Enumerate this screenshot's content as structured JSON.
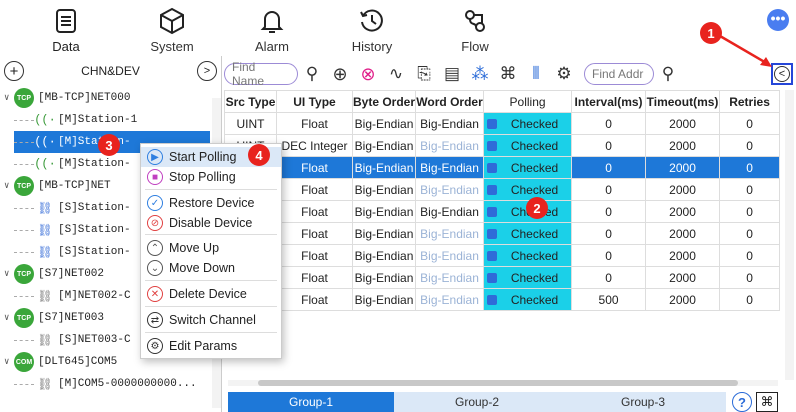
{
  "nav": {
    "tabs": [
      {
        "label": "Data",
        "icon": "list-icon"
      },
      {
        "label": "System",
        "icon": "cube-icon"
      },
      {
        "label": "Alarm",
        "icon": "bell-icon"
      },
      {
        "label": "History",
        "icon": "history-icon"
      },
      {
        "label": "Flow",
        "icon": "flow-icon"
      }
    ],
    "more": "•••"
  },
  "left": {
    "title": "CHN&DEV",
    "tree": [
      {
        "text": "[MB-TCP]NET000",
        "badge": "TCP"
      },
      {
        "text": "[M]Station-1"
      },
      {
        "text": "[M]Station-"
      },
      {
        "text": "[M]Station-"
      },
      {
        "text": "[MB-TCP]NET",
        "badge": "TCP"
      },
      {
        "text": "[S]Station-"
      },
      {
        "text": "[S]Station-"
      },
      {
        "text": "[S]Station-"
      },
      {
        "text": "[S7]NET002",
        "badge": "TCP"
      },
      {
        "text": "[M]NET002-C"
      },
      {
        "text": "[S7]NET003",
        "badge": "TCP"
      },
      {
        "text": "[S]NET003-C"
      },
      {
        "text": "[DLT645]COM5",
        "badge": "COM"
      },
      {
        "text": "[M]COM5-0000000000..."
      }
    ]
  },
  "toolbar": {
    "find_name_placeholder": "Find Name",
    "find_addr_placeholder": "Find Addr"
  },
  "table": {
    "headers": [
      "Src Type",
      "UI Type",
      "Byte Order",
      "Word Order",
      "Polling",
      "Interval(ms)",
      "Timeout(ms)",
      "Retries"
    ],
    "rows": [
      [
        "UINT",
        "Float",
        "Big-Endian",
        "Big-Endian",
        "Checked",
        "0",
        "2000",
        "0"
      ],
      [
        "UINT",
        "DEC Integer",
        "Big-Endian",
        "Big-Endian",
        "Checked",
        "0",
        "2000",
        "0"
      ],
      [
        "",
        "Float",
        "Big-Endian",
        "Big-Endian",
        "Checked",
        "0",
        "2000",
        "0"
      ],
      [
        "",
        "Float",
        "Big-Endian",
        "Big-Endian",
        "Checked",
        "0",
        "2000",
        "0"
      ],
      [
        "",
        "Float",
        "Big-Endian",
        "Big-Endian",
        "Checked",
        "0",
        "2000",
        "0"
      ],
      [
        "",
        "Float",
        "Big-Endian",
        "Big-Endian",
        "Checked",
        "0",
        "2000",
        "0"
      ],
      [
        "",
        "Float",
        "Big-Endian",
        "Big-Endian",
        "Checked",
        "0",
        "2000",
        "0"
      ],
      [
        "",
        "Float",
        "Big-Endian",
        "Big-Endian",
        "Checked",
        "0",
        "2000",
        "0"
      ],
      [
        "",
        "Float",
        "Big-Endian",
        "Big-Endian",
        "Checked",
        "500",
        "2000",
        "0"
      ]
    ],
    "dim_word_rows": [
      1,
      2,
      3,
      5,
      6,
      7,
      8
    ]
  },
  "groups": [
    "Group-1",
    "Group-2",
    "Group-3"
  ],
  "help": "?",
  "context_menu": [
    {
      "label": "Start Polling",
      "icon": "play-icon",
      "color": "#2f7fe0"
    },
    {
      "label": "Stop Polling",
      "icon": "stop-icon",
      "color": "#c040c0"
    },
    {
      "label": "Restore Device",
      "icon": "check-circle-icon",
      "color": "#2f7fe0"
    },
    {
      "label": "Disable Device",
      "icon": "disable-icon",
      "color": "#e04040"
    },
    {
      "label": "Move Up",
      "icon": "up-icon",
      "color": "#555555"
    },
    {
      "label": "Move Down",
      "icon": "down-icon",
      "color": "#555555"
    },
    {
      "label": "Delete Device",
      "icon": "delete-icon",
      "color": "#e04040"
    },
    {
      "label": "Switch Channel",
      "icon": "switch-icon",
      "color": "#333333"
    },
    {
      "label": "Edit Params",
      "icon": "gear-icon",
      "color": "#333333"
    }
  ],
  "annotations": [
    "1",
    "2",
    "3",
    "4"
  ]
}
